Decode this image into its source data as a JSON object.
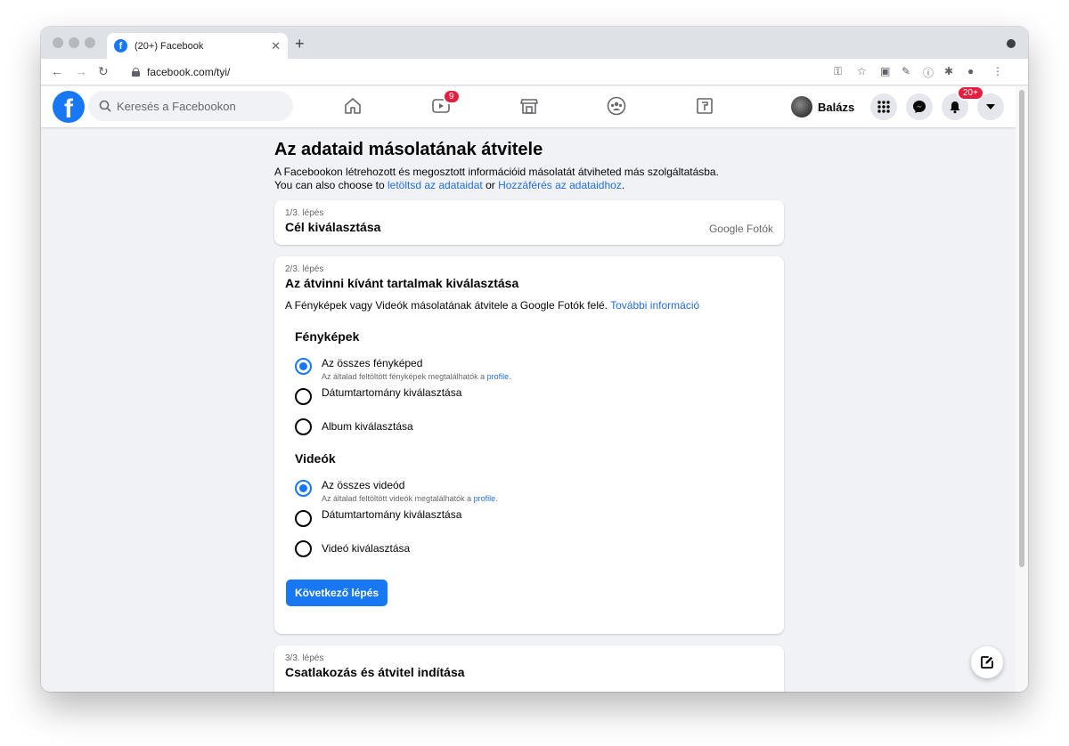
{
  "browser": {
    "tab_title": "(20+) Facebook",
    "tab_favicon": "f",
    "url": "facebook.com/tyi/",
    "icons": [
      "back-arrow-icon",
      "forward-arrow-icon",
      "reload-icon",
      "lock-icon",
      "key-icon",
      "star-icon",
      "extension-icons",
      "puzzle-icon",
      "account-icon",
      "kebab-menu-icon"
    ]
  },
  "fbnav": {
    "logo": "f",
    "search_placeholder": "Keresés a Facebookon",
    "watch_badge": "9",
    "profile_name": "Balázs",
    "notifications_badge": "20+",
    "brand_color": "#1877f2",
    "badge_color": "#e41e3f"
  },
  "page": {
    "title": "Az adataid másolatának átvitele",
    "desc_line1": "A Facebookon létrehozott és megosztott információid másolatát átviheted más szolgáltatásba.",
    "desc_line2_prefix": "You can also choose to ",
    "desc_link1": "letöltsd az adataidat",
    "desc_mid": " or ",
    "desc_link2": "Hozzáférés az adataidhoz",
    "desc_end": "."
  },
  "step1": {
    "step_label": "1/3. lépés",
    "title": "Cél kiválasztása",
    "value": "Google Fotók"
  },
  "step2": {
    "step_label": "2/3. lépés",
    "title": "Az átvinni kívánt tartalmak kiválasztása",
    "desc": "A Fényképek vagy Videók másolatának átvitele a Google Fotók felé. ",
    "desc_link": "További információ",
    "photos": {
      "title": "Fényképek",
      "options": [
        {
          "label": "Az összes fényképed",
          "sub": "Az általad feltöltött fényképek megtalálhatók a ",
          "sub_link": "profile",
          "sub_end": ".",
          "checked": true
        },
        {
          "label": "Dátumtartomány kiválasztása",
          "checked": false
        },
        {
          "label": "Album kiválasztása",
          "checked": false
        }
      ]
    },
    "videos": {
      "title": "Videók",
      "options": [
        {
          "label": "Az összes videód",
          "sub": "Az általad feltöltött videók megtalálhatók a ",
          "sub_link": "profile",
          "sub_end": ".",
          "checked": true
        },
        {
          "label": "Dátumtartomány kiválasztása",
          "checked": false
        },
        {
          "label": "Videó kiválasztása",
          "checked": false
        }
      ]
    },
    "next_button": "Következő lépés"
  },
  "step3": {
    "step_label": "3/3. lépés",
    "title": "Csatlakozás és átvitel indítása"
  }
}
